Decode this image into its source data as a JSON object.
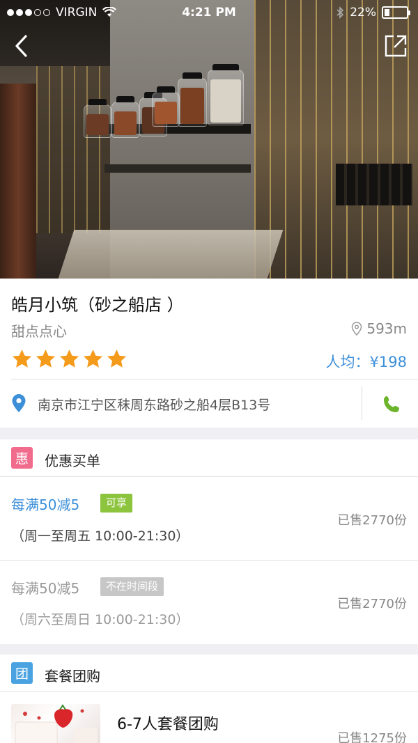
{
  "status_bar": {
    "carrier": "VIRGIN",
    "time": "4:21 PM",
    "battery": "22%",
    "battery_level": 0.22
  },
  "icons": {
    "back": "back-chevron-icon",
    "share": "share-icon",
    "location": "location-pin-icon",
    "phone": "phone-icon"
  },
  "store": {
    "name": "皓月小筑（砂之船店 ）",
    "category": "甜点点心",
    "distance": "593m",
    "rating": 5,
    "avg_price": "人均：¥198",
    "address": "南京市江宁区秣周东路砂之船4层B13号"
  },
  "colors": {
    "star": "#f59b1b",
    "accent_blue": "#3d8fd8",
    "available_green": "#8cc43e",
    "unavailable_gray": "#c7c7c7",
    "discount_badge": "#f06b8c",
    "group_badge": "#4aa3e0",
    "phone_green": "#6cb42c"
  },
  "discount_section": {
    "badge": "惠",
    "title": "优惠买单",
    "deals": [
      {
        "title": "每满50减5",
        "tag": "可享",
        "hours": "（周一至周五 10:00-21:30）",
        "sold": "已售2770份"
      },
      {
        "title": "每满50减5",
        "tag": "不在时间段",
        "hours": "（周六至周日 10:00-21:30）",
        "sold": "已售2770份"
      }
    ]
  },
  "group_section": {
    "badge": "团",
    "title": "套餐团购",
    "items": [
      {
        "title": "6-7人套餐团购",
        "sold": "已售1275份"
      }
    ]
  }
}
